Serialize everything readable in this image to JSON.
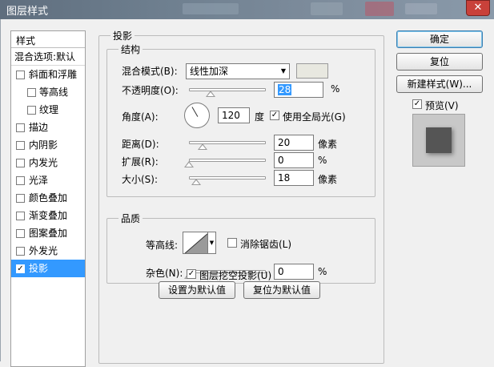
{
  "window": {
    "title": "图层样式",
    "close_glyph": "✕"
  },
  "style_list": {
    "header": "样式",
    "items": [
      {
        "label": "混合选项:默认",
        "type": "top"
      },
      {
        "label": "斜面和浮雕",
        "type": "lvl1",
        "checked": false
      },
      {
        "label": "等高线",
        "type": "lvl2",
        "checked": false
      },
      {
        "label": "纹理",
        "type": "lvl2",
        "checked": false
      },
      {
        "label": "描边",
        "type": "lvl1",
        "checked": false
      },
      {
        "label": "内阴影",
        "type": "lvl1",
        "checked": false
      },
      {
        "label": "内发光",
        "type": "lvl1",
        "checked": false
      },
      {
        "label": "光泽",
        "type": "lvl1",
        "checked": false
      },
      {
        "label": "颜色叠加",
        "type": "lvl1",
        "checked": false
      },
      {
        "label": "渐变叠加",
        "type": "lvl1",
        "checked": false
      },
      {
        "label": "图案叠加",
        "type": "lvl1",
        "checked": false
      },
      {
        "label": "外发光",
        "type": "lvl1",
        "checked": false
      },
      {
        "label": "投影",
        "type": "lvl1",
        "checked": true,
        "active": true
      }
    ]
  },
  "drop_shadow": {
    "title": "投影",
    "structure": {
      "title": "结构",
      "blend_mode_label": "混合模式(B):",
      "blend_mode_value": "线性加深",
      "opacity_label": "不透明度(O):",
      "opacity_value": "28",
      "opacity_fraction": 0.28,
      "percent": "%",
      "angle_label": "角度(A):",
      "angle_value": "120",
      "angle_unit": "度",
      "global_light_label": "使用全局光(G)",
      "global_light_checked": true,
      "distance_label": "距离(D):",
      "distance_value": "20",
      "spread_label": "扩展(R):",
      "spread_value": "0",
      "size_label": "大小(S):",
      "size_value": "18",
      "pixels_unit": "像素"
    },
    "quality": {
      "title": "品质",
      "contour_label": "等高线:",
      "antialias_label": "消除锯齿(L)",
      "antialias_checked": false,
      "noise_label": "杂色(N):",
      "noise_value": "0",
      "percent": "%"
    },
    "knockout_label": "图层挖空投影(U)",
    "knockout_checked": true,
    "set_default_label": "设置为默认值",
    "reset_default_label": "复位为默认值"
  },
  "buttons": {
    "ok": "确定",
    "reset": "复位",
    "new_style": "新建样式(W)...",
    "preview_label": "预览(V)",
    "preview_checked": true
  }
}
